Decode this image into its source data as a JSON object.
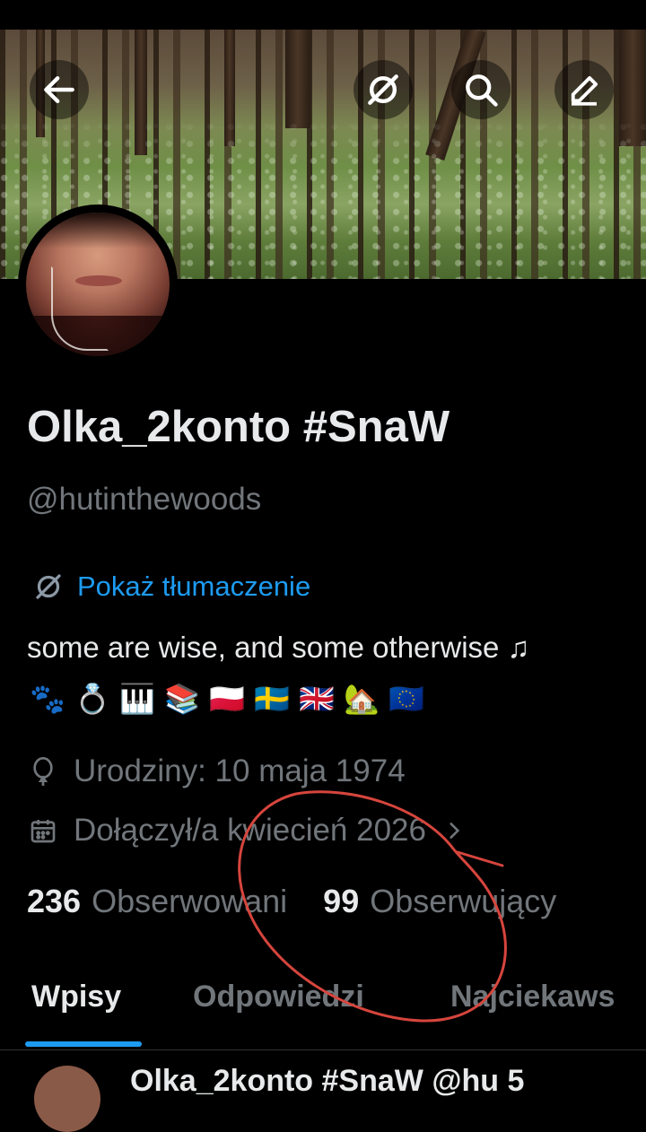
{
  "profile": {
    "display_name": "Olka_2konto #SnaW",
    "handle": "@hutinthewoods",
    "translate_label": "Pokaż tłumaczenie",
    "bio": "some are wise, and some otherwise ♫",
    "bio_emojis": [
      "🐾",
      "💍",
      "🎹",
      "📚",
      "🇵🇱",
      "🇸🇪",
      "🇬🇧",
      "🏡",
      "🇪🇺"
    ],
    "birthday": "Urodziny: 10 maja 1974",
    "joined": "Dołączył/a kwiecień 2026",
    "following_count": "236",
    "following_label": "Obserwowani",
    "followers_count": "99",
    "followers_label": "Obserwujący"
  },
  "header": {
    "icons": [
      "back-arrow-icon",
      "translate-icon",
      "search-icon",
      "edit-icon"
    ]
  },
  "tabs": [
    {
      "label": "Wpisy",
      "active": true
    },
    {
      "label": "Odpowiedzi",
      "active": false
    },
    {
      "label": "Najciekaws",
      "active": false
    }
  ],
  "next_post": {
    "author_preview": "Olka_2konto #SnaW @hu 5"
  },
  "colors": {
    "accent": "#1d9bf0",
    "annotation": "#d6453d",
    "secondary_text": "#71767b"
  }
}
